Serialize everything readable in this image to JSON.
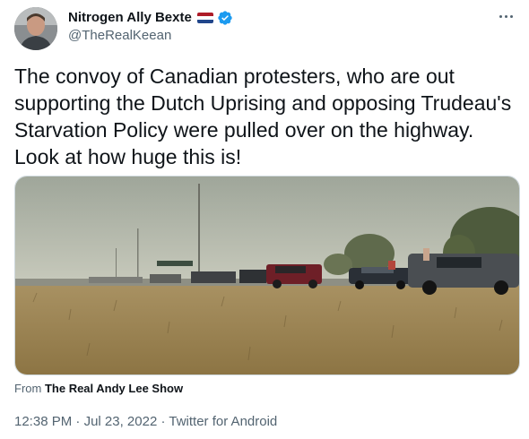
{
  "author": {
    "name": "Nitrogen Ally Bexte",
    "handle": "@TheRealKeean",
    "flag_icon": "netherlands-flag-icon",
    "verified_icon": "verified-badge-icon",
    "avatar_icon": "profile-photo"
  },
  "more_icon": "more-options-icon",
  "tweet": {
    "text": "The convoy of Canadian protesters, who are out supporting the Dutch Uprising and opposing Trudeau's Starvation Policy were pulled over on the highway. Look at how huge this is!"
  },
  "media": {
    "source_prefix": "From",
    "source_name": "The Real Andy Lee Show"
  },
  "meta": {
    "time": "12:38 PM",
    "separator1": "·",
    "date": "Jul 23, 2022",
    "separator2": "·",
    "client": "Twitter for Android"
  },
  "colors": {
    "primary_text": "#0f1419",
    "secondary_text": "#536471",
    "verified_blue": "#1d9bf0",
    "flag_red": "#ae1c28",
    "flag_white": "#ffffff",
    "flag_blue": "#21468b"
  }
}
